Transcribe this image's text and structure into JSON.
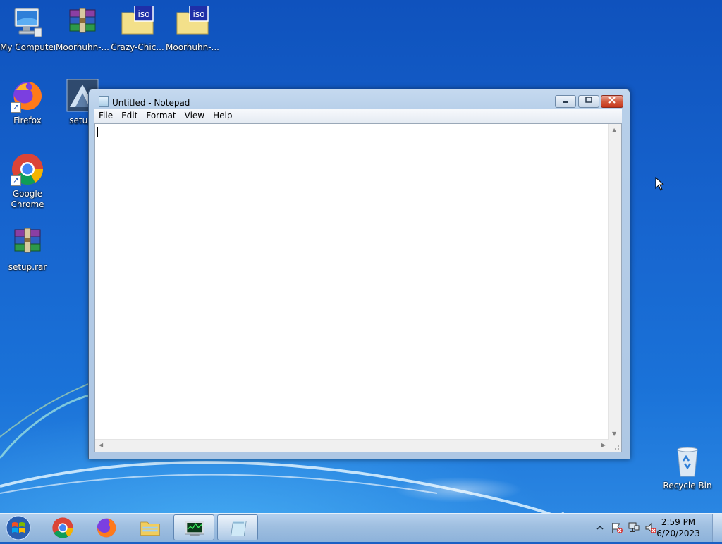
{
  "desktop": {
    "icons": [
      {
        "label": "My Computer",
        "icon": "computer-icon"
      },
      {
        "label": "Moorhuhn-...",
        "icon": "winrar-archive-icon"
      },
      {
        "label": "Crazy-Chic...",
        "icon": "iso-file-icon",
        "badge": "iso"
      },
      {
        "label": "Moorhuhn-...",
        "icon": "iso-file-icon",
        "badge": "iso"
      },
      {
        "label": "Firefox",
        "icon": "firefox-icon"
      },
      {
        "label": "setup.",
        "icon": "setup-icon"
      },
      {
        "label": "Google Chrome",
        "icon": "chrome-icon"
      },
      {
        "label": "setup.rar",
        "icon": "winrar-archive-icon"
      },
      {
        "label": "Recycle Bin",
        "icon": "recycle-bin-icon"
      }
    ]
  },
  "notepad": {
    "title": "Untitled - Notepad",
    "menu": [
      "File",
      "Edit",
      "Format",
      "View",
      "Help"
    ],
    "content": ""
  },
  "taskbar": {
    "pinned": [
      "chrome-icon",
      "firefox-icon",
      "file-explorer-icon",
      "task-manager-icon",
      "notepad-icon"
    ],
    "clock": {
      "time": "2:59 PM",
      "date": "6/20/2023"
    },
    "tray": [
      "show-hidden-icons-chevron",
      "action-center-flag-icon",
      "network-icon",
      "volume-muted-icon"
    ]
  },
  "colors": {
    "desktop_blue": "#1765cf",
    "close_red": "#c6371b",
    "taskbar": "#9fbfe0"
  }
}
